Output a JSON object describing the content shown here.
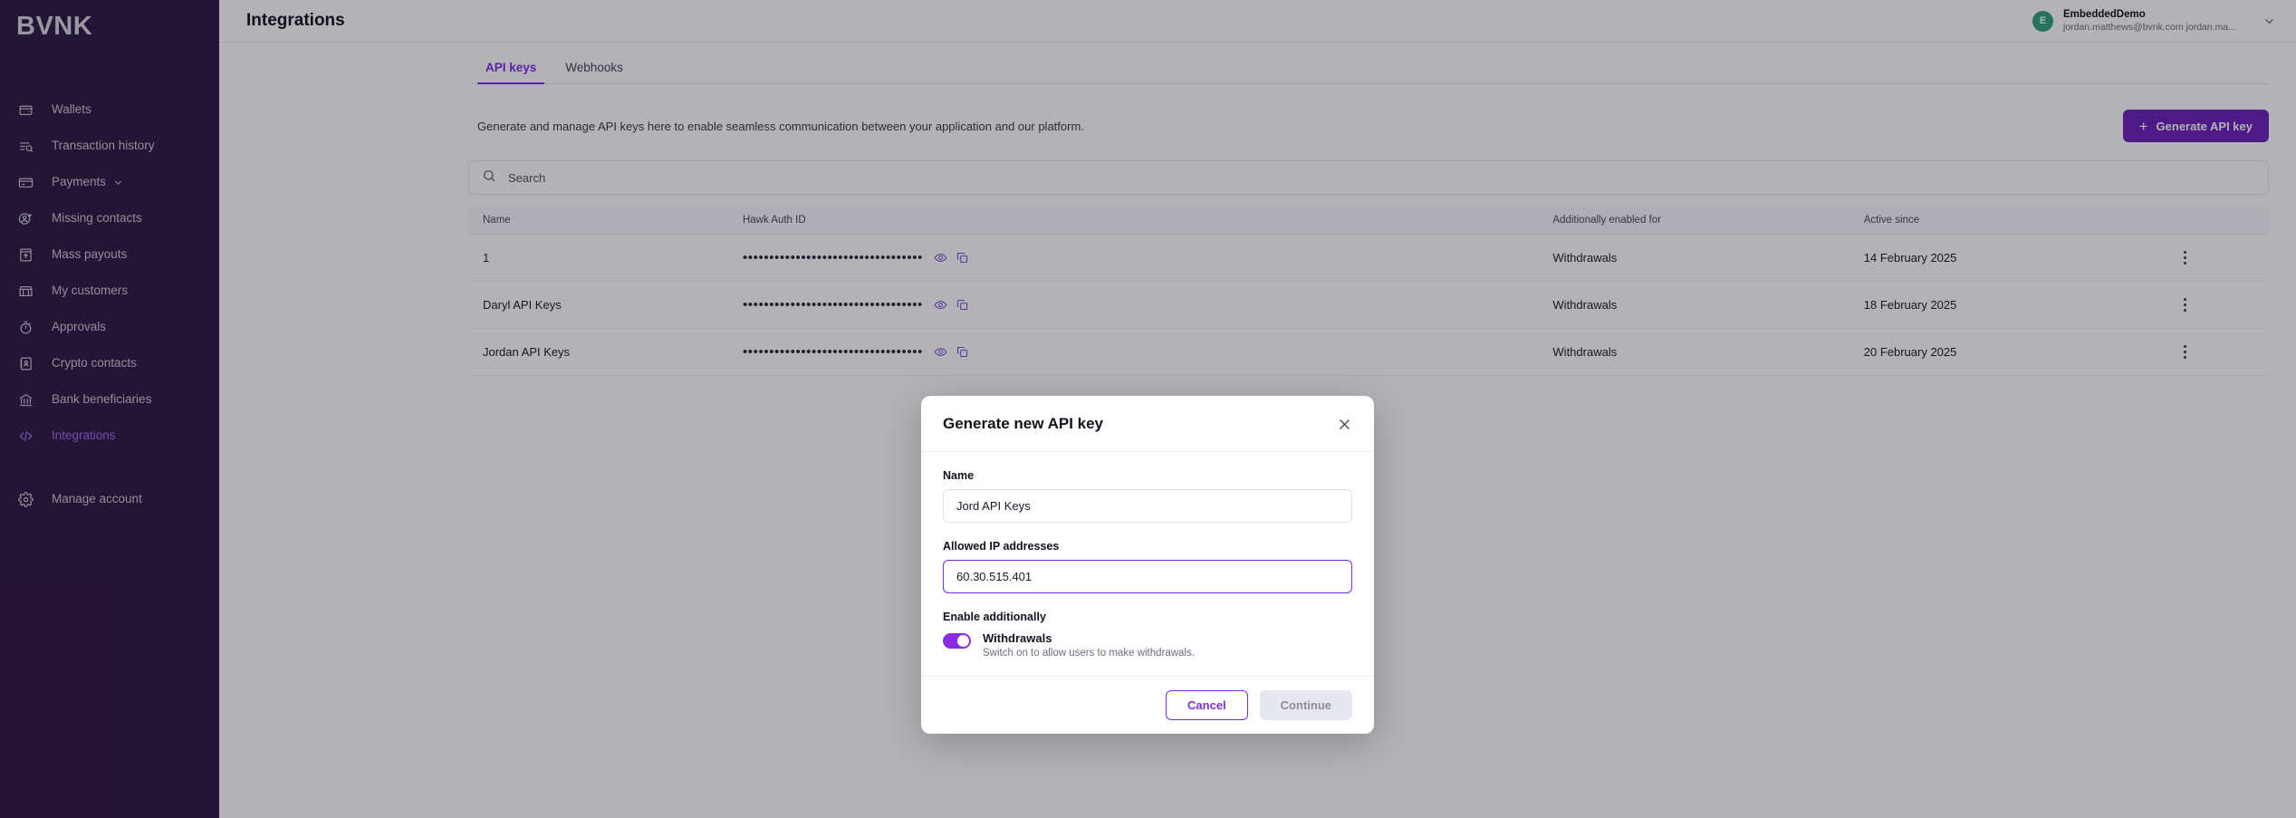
{
  "brand": {
    "name": "BVNK"
  },
  "sidebar": {
    "items": [
      {
        "label": "Wallets",
        "icon": "wallet-icon",
        "active": false
      },
      {
        "label": "Transaction history",
        "icon": "transaction-history-icon",
        "active": false
      },
      {
        "label": "Payments",
        "icon": "payments-card-icon",
        "active": false,
        "chevron": true
      },
      {
        "label": "Missing contacts",
        "icon": "missing-contacts-icon",
        "active": false
      },
      {
        "label": "Mass payouts",
        "icon": "mass-payouts-icon",
        "active": false
      },
      {
        "label": "My customers",
        "icon": "my-customers-icon",
        "active": false
      },
      {
        "label": "Approvals",
        "icon": "approvals-timer-icon",
        "active": false
      },
      {
        "label": "Crypto contacts",
        "icon": "crypto-contacts-icon",
        "active": false
      },
      {
        "label": "Bank beneficiaries",
        "icon": "bank-icon",
        "active": false
      },
      {
        "label": "Integrations",
        "icon": "code-brackets-icon",
        "active": true
      }
    ],
    "footer": {
      "label": "Manage account",
      "icon": "gear-icon"
    }
  },
  "header": {
    "title": "Integrations",
    "user": {
      "avatar_initial": "E",
      "name": "EmbeddedDemo",
      "email": "jordan.matthews@bvnk.com jordan.ma..."
    }
  },
  "tabs": [
    {
      "label": "API keys",
      "active": true
    },
    {
      "label": "Webhooks",
      "active": false
    }
  ],
  "content": {
    "description": "Generate and manage API keys here to enable seamless communication between your application and our platform.",
    "generate_button": "Generate API key",
    "search_placeholder": "Search",
    "search_value": ""
  },
  "table": {
    "columns": [
      "Name",
      "Hawk Auth ID",
      "Additionally enabled for",
      "Active since",
      ""
    ],
    "masked_value": "••••••••••••••••••••••••••••••••••",
    "rows": [
      {
        "name": "1",
        "hawk": "••••••••••••••••••••••••••••••••••",
        "additionally": "Withdrawals",
        "active_since": "14 February 2025"
      },
      {
        "name": "Daryl API Keys",
        "hawk": "••••••••••••••••••••••••••••••••••",
        "additionally": "Withdrawals",
        "active_since": "18 February 2025"
      },
      {
        "name": "Jordan API Keys",
        "hawk": "••••••••••••••••••••••••••••••••••",
        "additionally": "Withdrawals",
        "active_since": "20 February 2025"
      }
    ]
  },
  "modal": {
    "title": "Generate new API key",
    "name_label": "Name",
    "name_value": "Jord API Keys",
    "ip_label": "Allowed IP addresses",
    "ip_value": "60.30.515.401",
    "enable_label": "Enable additionally",
    "toggle_title": "Withdrawals",
    "toggle_sub": "Switch on to allow users to make withdrawals.",
    "toggle_on": true,
    "cancel_label": "Cancel",
    "continue_label": "Continue"
  },
  "colors": {
    "sidebar_bg": "#2c1842",
    "accent_purple": "#7d2ae8",
    "brand_button": "#6b21b8",
    "toggle_on": "#8a2be2",
    "avatar_green": "#2ea37a"
  }
}
